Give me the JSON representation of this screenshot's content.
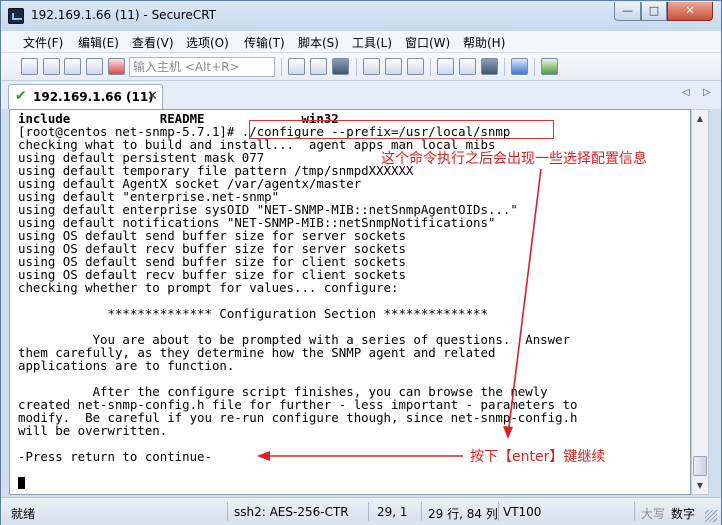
{
  "window": {
    "title": "192.169.1.66 (11) - SecureCRT",
    "buttons": {
      "minimize": "—",
      "maximize": "□",
      "close": "✕"
    }
  },
  "menu": [
    "文件(F)",
    "编辑(E)",
    "查看(V)",
    "选项(O)",
    "传输(T)",
    "脚本(S)",
    "工具(L)",
    "窗口(W)",
    "帮助(H)"
  ],
  "toolbar": {
    "host_placeholder": "输入主机 <Alt+R>"
  },
  "tab": {
    "label": "192.169.1.66 (11)",
    "close": "✕",
    "nav_left": "◁",
    "nav_right": "▷"
  },
  "terminal": {
    "lines": [
      "include            README             win32",
      "[root@centos net-snmp-5.7.1]# ./configure --prefix=/usr/local/snmp",
      "checking what to build and install...  agent apps man local mibs",
      "using default persistent mask 077",
      "using default temporary file pattern /tmp/snmpdXXXXXX",
      "using default AgentX socket /var/agentx/master",
      "using default \"enterprise.net-snmp\"",
      "using default enterprise sysOID \"NET-SNMP-MIB::netSnmpAgentOIDs...\"",
      "using default notifications \"NET-SNMP-MIB::netSnmpNotifications\"",
      "using OS default send buffer size for server sockets",
      "using OS default recv buffer size for server sockets",
      "using OS default send buffer size for client sockets",
      "using OS default recv buffer size for client sockets",
      "checking whether to prompt for values... configure:",
      "",
      "            ************** Configuration Section **************",
      "",
      "          You are about to be prompted with a series of questions.  Answer",
      "them carefully, as they determine how the SNMP agent and related",
      "applications are to function.",
      "",
      "          After the configure script finishes, you can browse the newly",
      "created net-snmp-config.h file for further - less important - parameters to",
      "modify.  Be careful if you re-run configure though, since net-snmp-config.h",
      "will be overwritten.",
      "",
      "-Press return to continue-"
    ]
  },
  "annotations": {
    "config_note": "这个命令执行之后会出现一些选择配置信息",
    "enter_note": "按下【enter】键继续",
    "color": "#e02020"
  },
  "status": {
    "state": "就绪",
    "encryption": "ssh2: AES-256-CTR",
    "position": "29,   1",
    "size": "29 行, 84 列",
    "terminal": "VT100",
    "caps": "大写",
    "num": "数字"
  }
}
